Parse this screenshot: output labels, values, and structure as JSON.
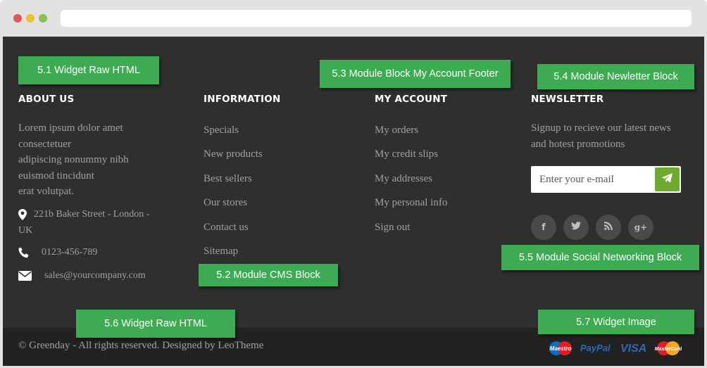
{
  "browser": {
    "window_buttons": [
      "close",
      "minimize",
      "maximize"
    ]
  },
  "labels": {
    "l51": "5.1 Widget Raw HTML",
    "l52": "5.2 Module CMS Block",
    "l53": "5.3 Module Block My Account Footer",
    "l54": "5.4 Module Newletter Block",
    "l55": "5.5 Module Social Networking Block",
    "l56": "5.6 Widget Raw HTML",
    "l57": "5.7 Widget Image"
  },
  "about": {
    "title": "ABOUT US",
    "text_lines": [
      "Lorem ipsum dolor amet",
      "consectetuer",
      "adipiscing nonummy nibh",
      "euismod tincidunt",
      "erat volutpat."
    ],
    "address_line1": "221b Baker Street - London -",
    "address_line2": "UK",
    "phone": "0123-456-789",
    "email": "sales@yourcompany.com",
    "icons": [
      "map-marker-icon",
      "phone-icon",
      "envelope-icon"
    ]
  },
  "information": {
    "title": "INFORMATION",
    "links": [
      "Specials",
      "New products",
      "Best sellers",
      "Our stores",
      "Contact us",
      "Sitemap"
    ]
  },
  "account": {
    "title": "MY ACCOUNT",
    "links": [
      "My orders",
      "My credit slips",
      "My addresses",
      "My personal info",
      "Sign out"
    ]
  },
  "newsletter": {
    "title": "NEWSLETTER",
    "text_line1": "Signup to recieve our latest news",
    "text_line2": "and hotest promotions",
    "email_placeholder": "Enter your e-mail",
    "submit_icon": "paper-plane-icon",
    "accent_color": "#6eaa2e"
  },
  "social": {
    "icons": [
      {
        "name": "facebook-icon",
        "glyph": "f"
      },
      {
        "name": "twitter-icon",
        "glyph": "t"
      },
      {
        "name": "rss-icon",
        "glyph": "rss"
      },
      {
        "name": "google-plus-icon",
        "glyph": "g+"
      }
    ]
  },
  "bottom": {
    "copyright": "© Greenday - All rights reserved. Designed by LeoTheme",
    "payment_icons": [
      "maestro-icon",
      "paypal-icon",
      "visa-icon",
      "mastercard-icon"
    ]
  },
  "colors": {
    "label_green": "#3cab52",
    "footer_bg": "#2f2f2f",
    "bottom_bg": "#222222",
    "text_gray": "#a0a0a0"
  }
}
